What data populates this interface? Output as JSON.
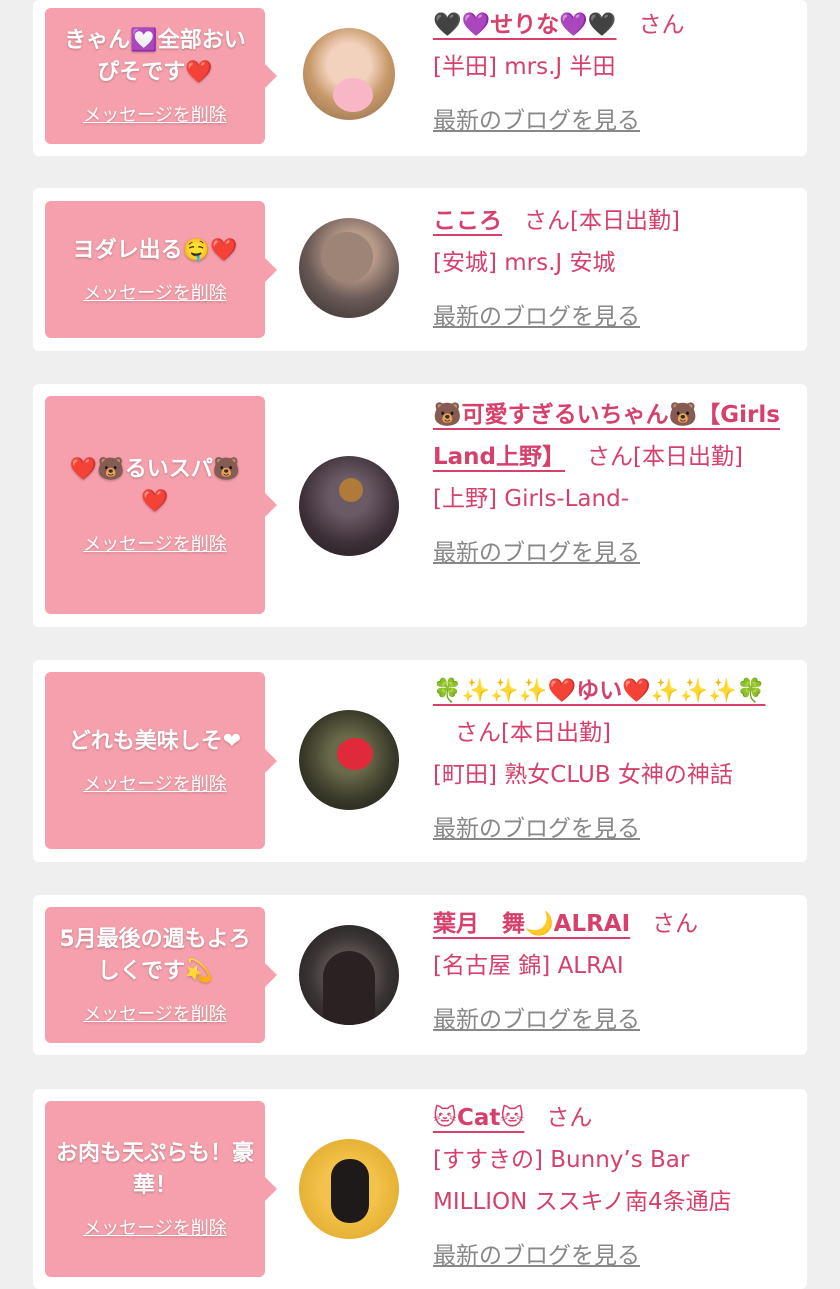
{
  "colors": {
    "accent": "#d6406b",
    "bubble": "#f5a0ac",
    "background": "#efefef",
    "link_gray": "#888888"
  },
  "delete_label": "メッセージを削除",
  "blog_label": "最新のブログを見る",
  "entries": [
    {
      "message": "きゃん💟全部おいぴそです❤️",
      "name": "🖤💜せりな💜🖤",
      "suffix": "さん",
      "shop": "[半田] mrs.J 半田"
    },
    {
      "message": "ヨダレ出る🤤❤️",
      "name": "こころ",
      "suffix": "さん[本日出勤]",
      "shop": "[安城] mrs.J 安城"
    },
    {
      "message": "❤️🐻るいスパ🐻❤️",
      "name": "🐻可愛すぎるいちゃん🐻【Girls Land上野】",
      "suffix": "さん[本日出勤]",
      "shop": "[上野] Girls-Land-"
    },
    {
      "message": "どれも美味しそ❤",
      "name": "🍀✨✨✨❤️ゆい❤️✨✨✨🍀",
      "suffix": "さん[本日出勤]",
      "shop": "[町田] 熟女CLUB 女神の神話"
    },
    {
      "message": "5月最後の週もよろしくです💫",
      "name": "葉月　舞🌙ALRAI",
      "suffix": "さん",
      "shop": "[名古屋 錦] ALRAI"
    },
    {
      "message": "お肉も天ぷらも！豪華！",
      "name": "🐱Cat🐱",
      "suffix": "さん",
      "shop": "[すすきの] Bunny’s Bar MILLION ススキノ南4条通店"
    }
  ]
}
